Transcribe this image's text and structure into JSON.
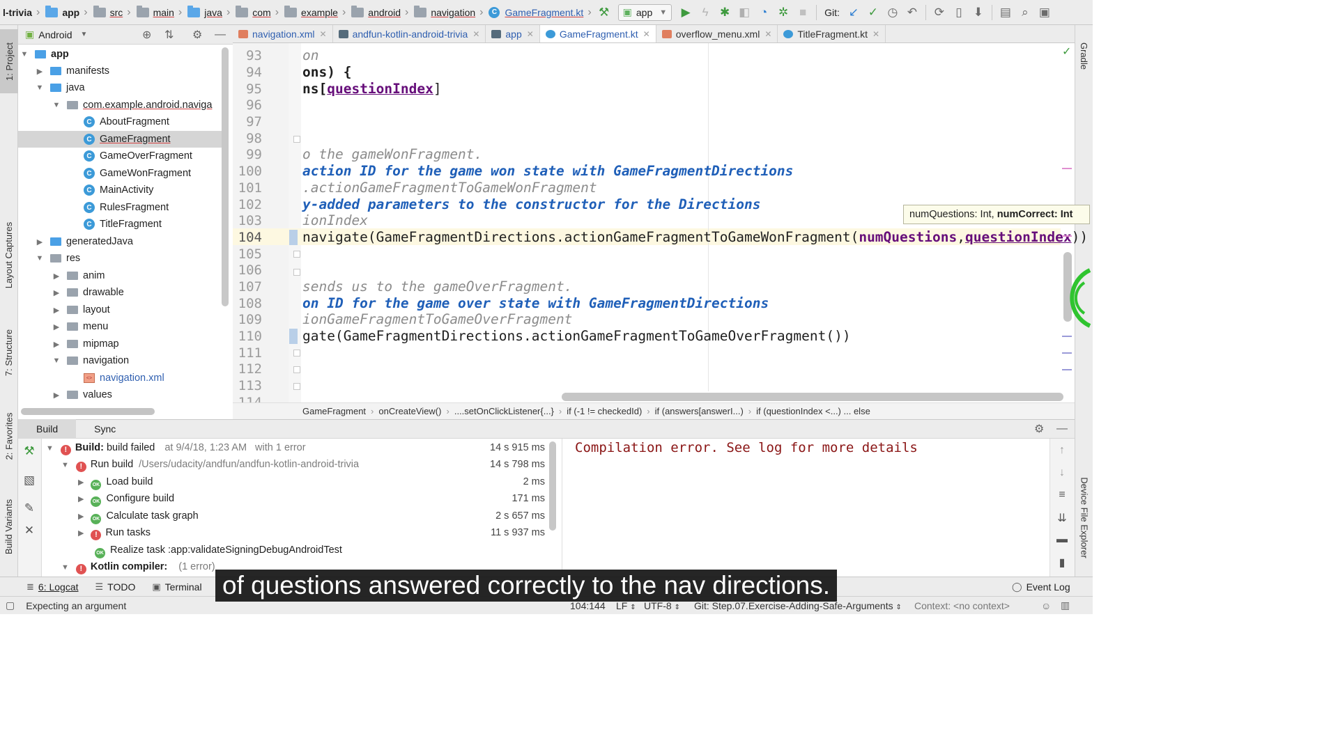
{
  "topbar": {
    "breadcrumbs": [
      "l-trivia",
      "app",
      "src",
      "main",
      "java",
      "com",
      "example",
      "android",
      "navigation",
      "GameFragment.kt"
    ],
    "run_config": "app",
    "git_label": "Git:"
  },
  "left_strip": {
    "project": "1: Project",
    "layout_captures": "Layout Captures",
    "structure": "7: Structure",
    "favorites": "2: Favorites",
    "build_variants": "Build Variants"
  },
  "right_strip": {
    "gradle": "Gradle",
    "device_file_explorer": "Device File Explorer"
  },
  "project_panel": {
    "view_mode": "Android",
    "tree": [
      {
        "label": "app",
        "bold": true
      },
      {
        "label": "manifests"
      },
      {
        "label": "java"
      },
      {
        "label": "com.example.android.naviga"
      },
      {
        "label": "AboutFragment"
      },
      {
        "label": "GameFragment"
      },
      {
        "label": "GameOverFragment"
      },
      {
        "label": "GameWonFragment"
      },
      {
        "label": "MainActivity"
      },
      {
        "label": "RulesFragment"
      },
      {
        "label": "TitleFragment"
      },
      {
        "label": "generatedJava"
      },
      {
        "label": "res"
      },
      {
        "label": "anim"
      },
      {
        "label": "drawable"
      },
      {
        "label": "layout"
      },
      {
        "label": "menu"
      },
      {
        "label": "mipmap"
      },
      {
        "label": "navigation"
      },
      {
        "label": "navigation.xml"
      },
      {
        "label": "values"
      }
    ]
  },
  "editor_tabs": [
    {
      "label": "navigation.xml"
    },
    {
      "label": "andfun-kotlin-android-trivia"
    },
    {
      "label": "app"
    },
    {
      "label": "GameFragment.kt",
      "active": true
    },
    {
      "label": "overflow_menu.xml"
    },
    {
      "label": "TitleFragment.kt"
    }
  ],
  "editor": {
    "line_numbers": [
      "93",
      "94",
      "95",
      "96",
      "97",
      "98",
      "99",
      "100",
      "101",
      "102",
      "103",
      "104",
      "105",
      "106",
      "107",
      "108",
      "109",
      "110",
      "111",
      "112",
      "113",
      "114"
    ],
    "code": {
      "l93": "on",
      "l94": "ons) {",
      "l95_pre": "ns[",
      "l95_idx": "questionIndex",
      "l95_post": "]",
      "l99": "o the gameWonFragment.",
      "l100": "action ID for the game won state with GameFragmentDirections",
      "l101": ".actionGameFragmentToGameWonFragment",
      "l102": "y-added parameters to the constructor for the Directions",
      "l103": "ionIndex",
      "l104_pre": "navigate(GameFragmentDirections.actionGameFragmentToGameWonFragment(",
      "l104_arg1": "numQuestions",
      "l104_comma": ",",
      "l104_arg2": "questionIndex",
      "l104_post": "))",
      "l107": "sends us to the gameOverFragment.",
      "l108": "on ID for the game over state with GameFragmentDirections",
      "l109": "ionGameFragmentToGameOverFragment",
      "l110": "gate(GameFragmentDirections.actionGameFragmentToGameOverFragment())"
    },
    "tooltip_plain": "numQuestions: Int, ",
    "tooltip_bold": "numCorrect: Int"
  },
  "breadcrumb": [
    "GameFragment",
    "onCreateView()",
    "....setOnClickListener{...}",
    "if (-1 != checkedId)",
    "if (answers[answerI...)",
    "if (questionIndex <...) ... else"
  ],
  "build_panel": {
    "tabs": [
      "Build",
      "Sync"
    ],
    "rows": [
      {
        "label_bold": "Build:",
        "label": " build failed",
        "meta": "at 9/4/18, 1:23 AM",
        "meta2": "with 1 error",
        "time": "14 s 915 ms"
      },
      {
        "label": "Run build",
        "meta": "/Users/udacity/andfun/andfun-kotlin-android-trivia",
        "time": "14 s 798 ms"
      },
      {
        "label": "Load build",
        "time": "2 ms"
      },
      {
        "label": "Configure build",
        "time": "171 ms"
      },
      {
        "label": "Calculate task graph",
        "time": "2 s 657 ms"
      },
      {
        "label": "Run tasks",
        "time": "11 s 937 ms"
      },
      {
        "label": "Realize task :app:validateSigningDebugAndroidTest",
        "time": ""
      },
      {
        "label_bold": "Kotlin compiler:",
        "meta": "(1 error)",
        "time": ""
      }
    ],
    "output": "Compilation error. See log for more details"
  },
  "bottom_tools": {
    "logcat": "6: Logcat",
    "todo": "TODO",
    "terminal": "Terminal",
    "event_log": "Event Log"
  },
  "status": {
    "message": "Expecting an argument",
    "position": "104:144",
    "line_sep": "LF",
    "encoding": "UTF-8",
    "git_branch": "Git: Step.07.Exercise-Adding-Safe-Arguments",
    "context": "Context: <no context>"
  },
  "caption": "of questions answered correctly to the nav directions.",
  "colors": {
    "keyword_blue": "#1f5fb8",
    "param_purple": "#660e7a",
    "error_red": "#e05252",
    "ok_green": "#58b158",
    "error_text": "#8a1515"
  }
}
